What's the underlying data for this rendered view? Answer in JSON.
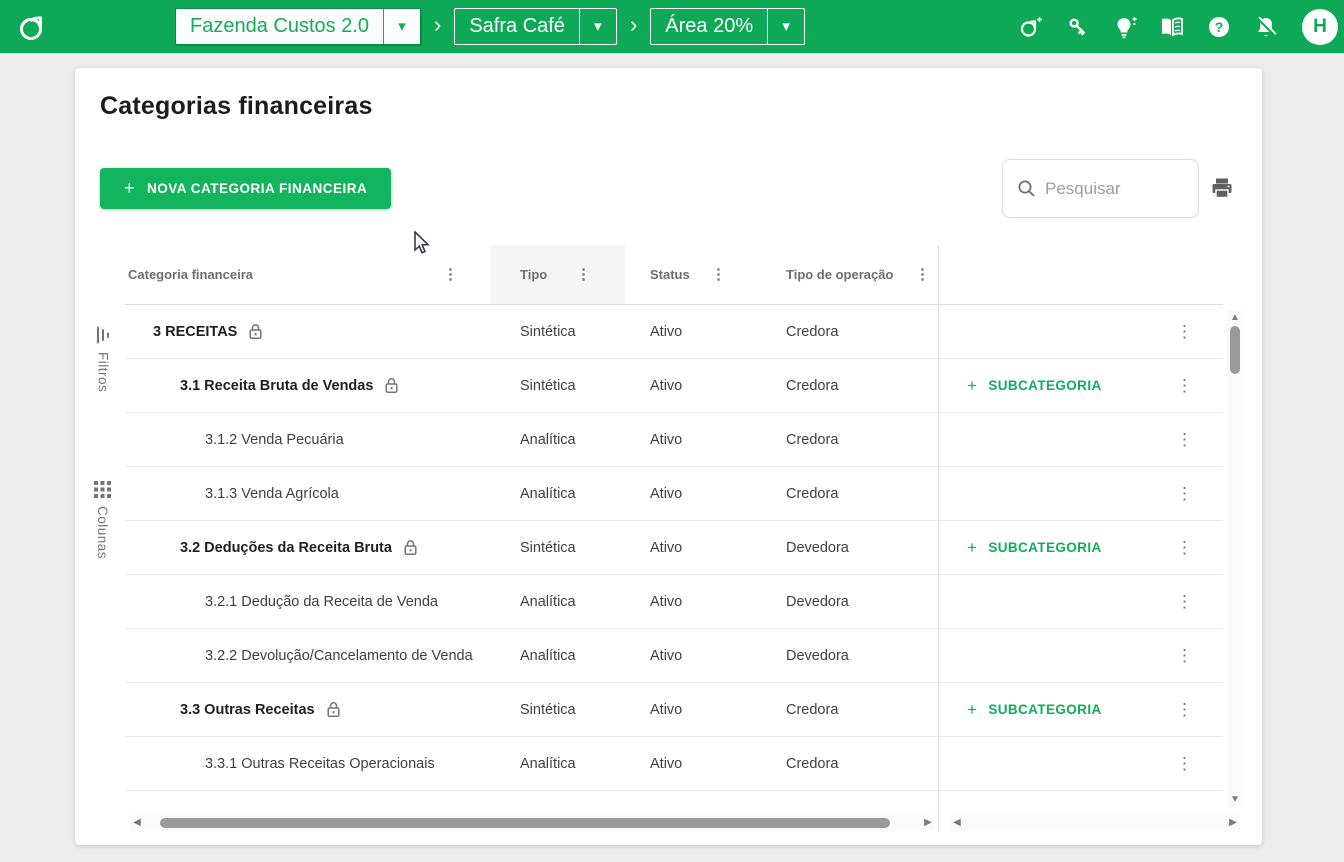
{
  "colors": {
    "header_green": "#0ea957",
    "button_green": "#12b55d",
    "link_green": "#0fad5c",
    "text_dark": "#1c1c1c",
    "text_gray": "#757575"
  },
  "icons": {
    "caret_down": "▾",
    "chevron_right": "›",
    "kebab": "⋮",
    "plus": "+",
    "question_mark": "?",
    "arrow_up": "▲",
    "arrow_down": "▼",
    "arrow_left": "◀",
    "arrow_right": "▶"
  },
  "header": {
    "breadcrumb": [
      {
        "label": "Fazenda Custos 2.0"
      },
      {
        "label": "Safra Café"
      },
      {
        "label": "Área 20%"
      }
    ],
    "avatar_initial": "H"
  },
  "page": {
    "title": "Categorias financeiras",
    "new_category_label": "NOVA CATEGORIA FINANCEIRA",
    "search_placeholder": "Pesquisar"
  },
  "rail": {
    "filters_label": "Filtros",
    "columns_label": "Colunas"
  },
  "table": {
    "columns": [
      {
        "label": "Categoria financeira"
      },
      {
        "label": "Tipo"
      },
      {
        "label": "Status"
      },
      {
        "label": "Tipo de operação"
      }
    ],
    "subcategory_label": "SUBCATEGORIA",
    "rows": [
      {
        "name": "3 RECEITAS",
        "level": 1,
        "locked": true,
        "tipo": "Sintética",
        "status": "Ativo",
        "operacao": "Credora",
        "subcategory_button": false
      },
      {
        "name": "3.1 Receita Bruta de Vendas",
        "level": 2,
        "locked": true,
        "tipo": "Sintética",
        "status": "Ativo",
        "operacao": "Credora",
        "subcategory_button": true
      },
      {
        "name": "3.1.2 Venda Pecuária",
        "level": 3,
        "locked": false,
        "tipo": "Analítica",
        "status": "Ativo",
        "operacao": "Credora",
        "subcategory_button": false
      },
      {
        "name": "3.1.3 Venda Agrícola",
        "level": 3,
        "locked": false,
        "tipo": "Analítica",
        "status": "Ativo",
        "operacao": "Credora",
        "subcategory_button": false
      },
      {
        "name": "3.2 Deduções da Receita Bruta",
        "level": 2,
        "locked": true,
        "tipo": "Sintética",
        "status": "Ativo",
        "operacao": "Devedora",
        "subcategory_button": true
      },
      {
        "name": "3.2.1 Dedução da Receita de Venda",
        "level": 3,
        "locked": false,
        "tipo": "Analítica",
        "status": "Ativo",
        "operacao": "Devedora",
        "subcategory_button": false
      },
      {
        "name": "3.2.2 Devolução/Cancelamento de Venda",
        "level": 3,
        "locked": false,
        "tipo": "Analítica",
        "status": "Ativo",
        "operacao": "Devedora",
        "subcategory_button": false
      },
      {
        "name": "3.3 Outras Receitas",
        "level": 2,
        "locked": true,
        "tipo": "Sintética",
        "status": "Ativo",
        "operacao": "Credora",
        "subcategory_button": true
      },
      {
        "name": "3.3.1 Outras Receitas Operacionais",
        "level": 3,
        "locked": false,
        "tipo": "Analítica",
        "status": "Ativo",
        "operacao": "Credora",
        "subcategory_button": false
      }
    ]
  }
}
